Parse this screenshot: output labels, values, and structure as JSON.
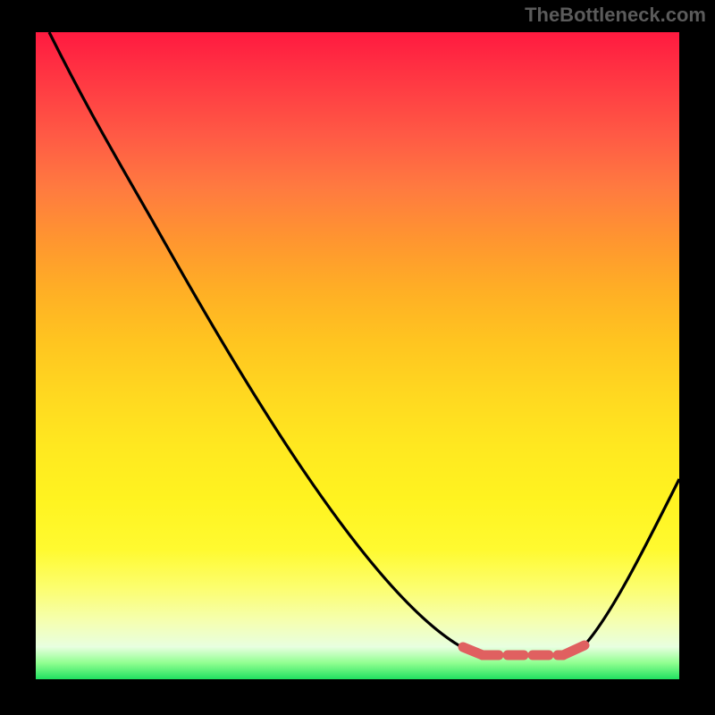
{
  "watermark": "TheBottleneck.com",
  "chart_data": {
    "type": "line",
    "title": "",
    "xlabel": "",
    "ylabel": "",
    "xlim": [
      0,
      100
    ],
    "ylim": [
      0,
      100
    ],
    "series": [
      {
        "name": "bottleneck-curve",
        "x": [
          2,
          10,
          20,
          30,
          40,
          50,
          60,
          67,
          70,
          80,
          82,
          85,
          90,
          95,
          100
        ],
        "y": [
          100,
          86,
          70,
          55,
          40,
          26,
          13,
          5,
          3,
          3,
          3,
          5,
          13,
          23,
          31
        ]
      }
    ],
    "annotations": [
      {
        "name": "optimum-range",
        "x_start": 66,
        "x_end": 85,
        "y": 3,
        "color": "#e06060"
      }
    ],
    "background_gradient": {
      "top": "#ff1a40",
      "mid": "#ffe820",
      "bottom": "#20e060",
      "meaning": "red = high bottleneck, green = low bottleneck"
    }
  },
  "colors": {
    "page_background": "#000000",
    "curve": "#000000",
    "optimum_marker": "#e06060",
    "watermark": "#5b5b5b"
  }
}
